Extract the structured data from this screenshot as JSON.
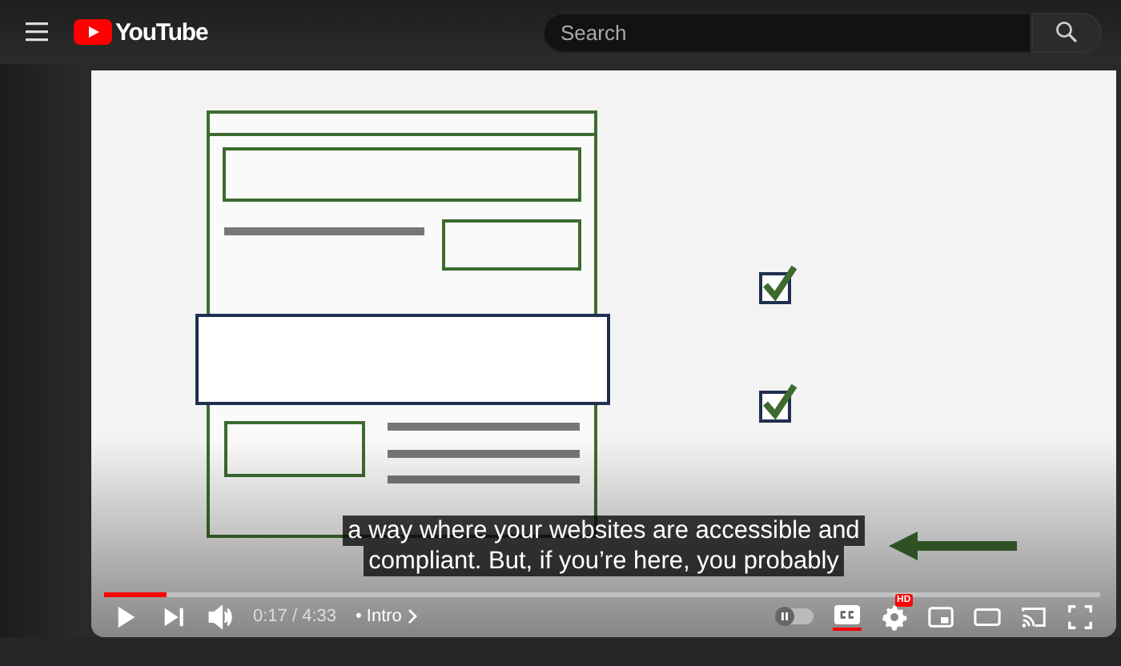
{
  "header": {
    "logo": "YouTube",
    "search": {
      "placeholder": "Search"
    }
  },
  "player": {
    "captions": [
      "a way where your websites are accessible and",
      "compliant. But, if you’re here, you probably"
    ],
    "progress": {
      "level": 0.063
    },
    "time": "0:17 / 4:33",
    "separator": "•",
    "chapter": "Intro",
    "autoplay": {
      "on": false
    },
    "subtitles": {
      "on": true
    },
    "settings_badge": "HD"
  }
}
